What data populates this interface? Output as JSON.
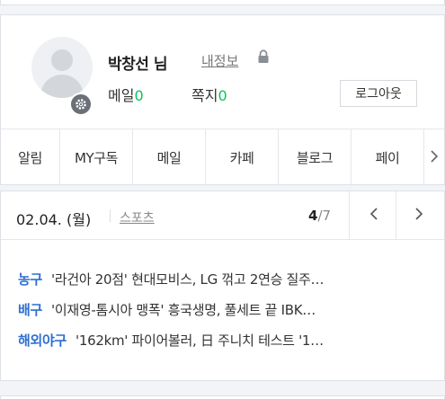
{
  "account": {
    "user_name": "박창선 님",
    "my_info": "내정보",
    "mail_label": "메일",
    "mail_count": "0",
    "note_label": "쪽지",
    "note_count": "0",
    "logout_label": "로그아웃",
    "icons": {
      "avatar": "default-user-avatar",
      "settings": "gear-icon",
      "lock": "lock-icon"
    }
  },
  "services": [
    {
      "label": "알림"
    },
    {
      "label": "MY구독"
    },
    {
      "label": "메일"
    },
    {
      "label": "카페"
    },
    {
      "label": "블로그"
    },
    {
      "label": "페이"
    }
  ],
  "news": {
    "date": "02.04. (월)",
    "category": "스포츠",
    "page_current": "4",
    "page_total": "/7",
    "items": [
      {
        "tag": "농구",
        "title": "'라건아 20점' 현대모비스, LG 꺾고 2연승 질주…"
      },
      {
        "tag": "배구",
        "title": "'이재영-톰시아 맹폭' 흥국생명, 풀세트 끝 IBK…"
      },
      {
        "tag": "해외야구",
        "title": "'162km' 파이어볼러, 日 주니치 테스트 '1…"
      }
    ]
  },
  "colors": {
    "accent_green": "#03c75a",
    "tag_blue": "#2e6fd1",
    "background": "#f2f4f7"
  }
}
